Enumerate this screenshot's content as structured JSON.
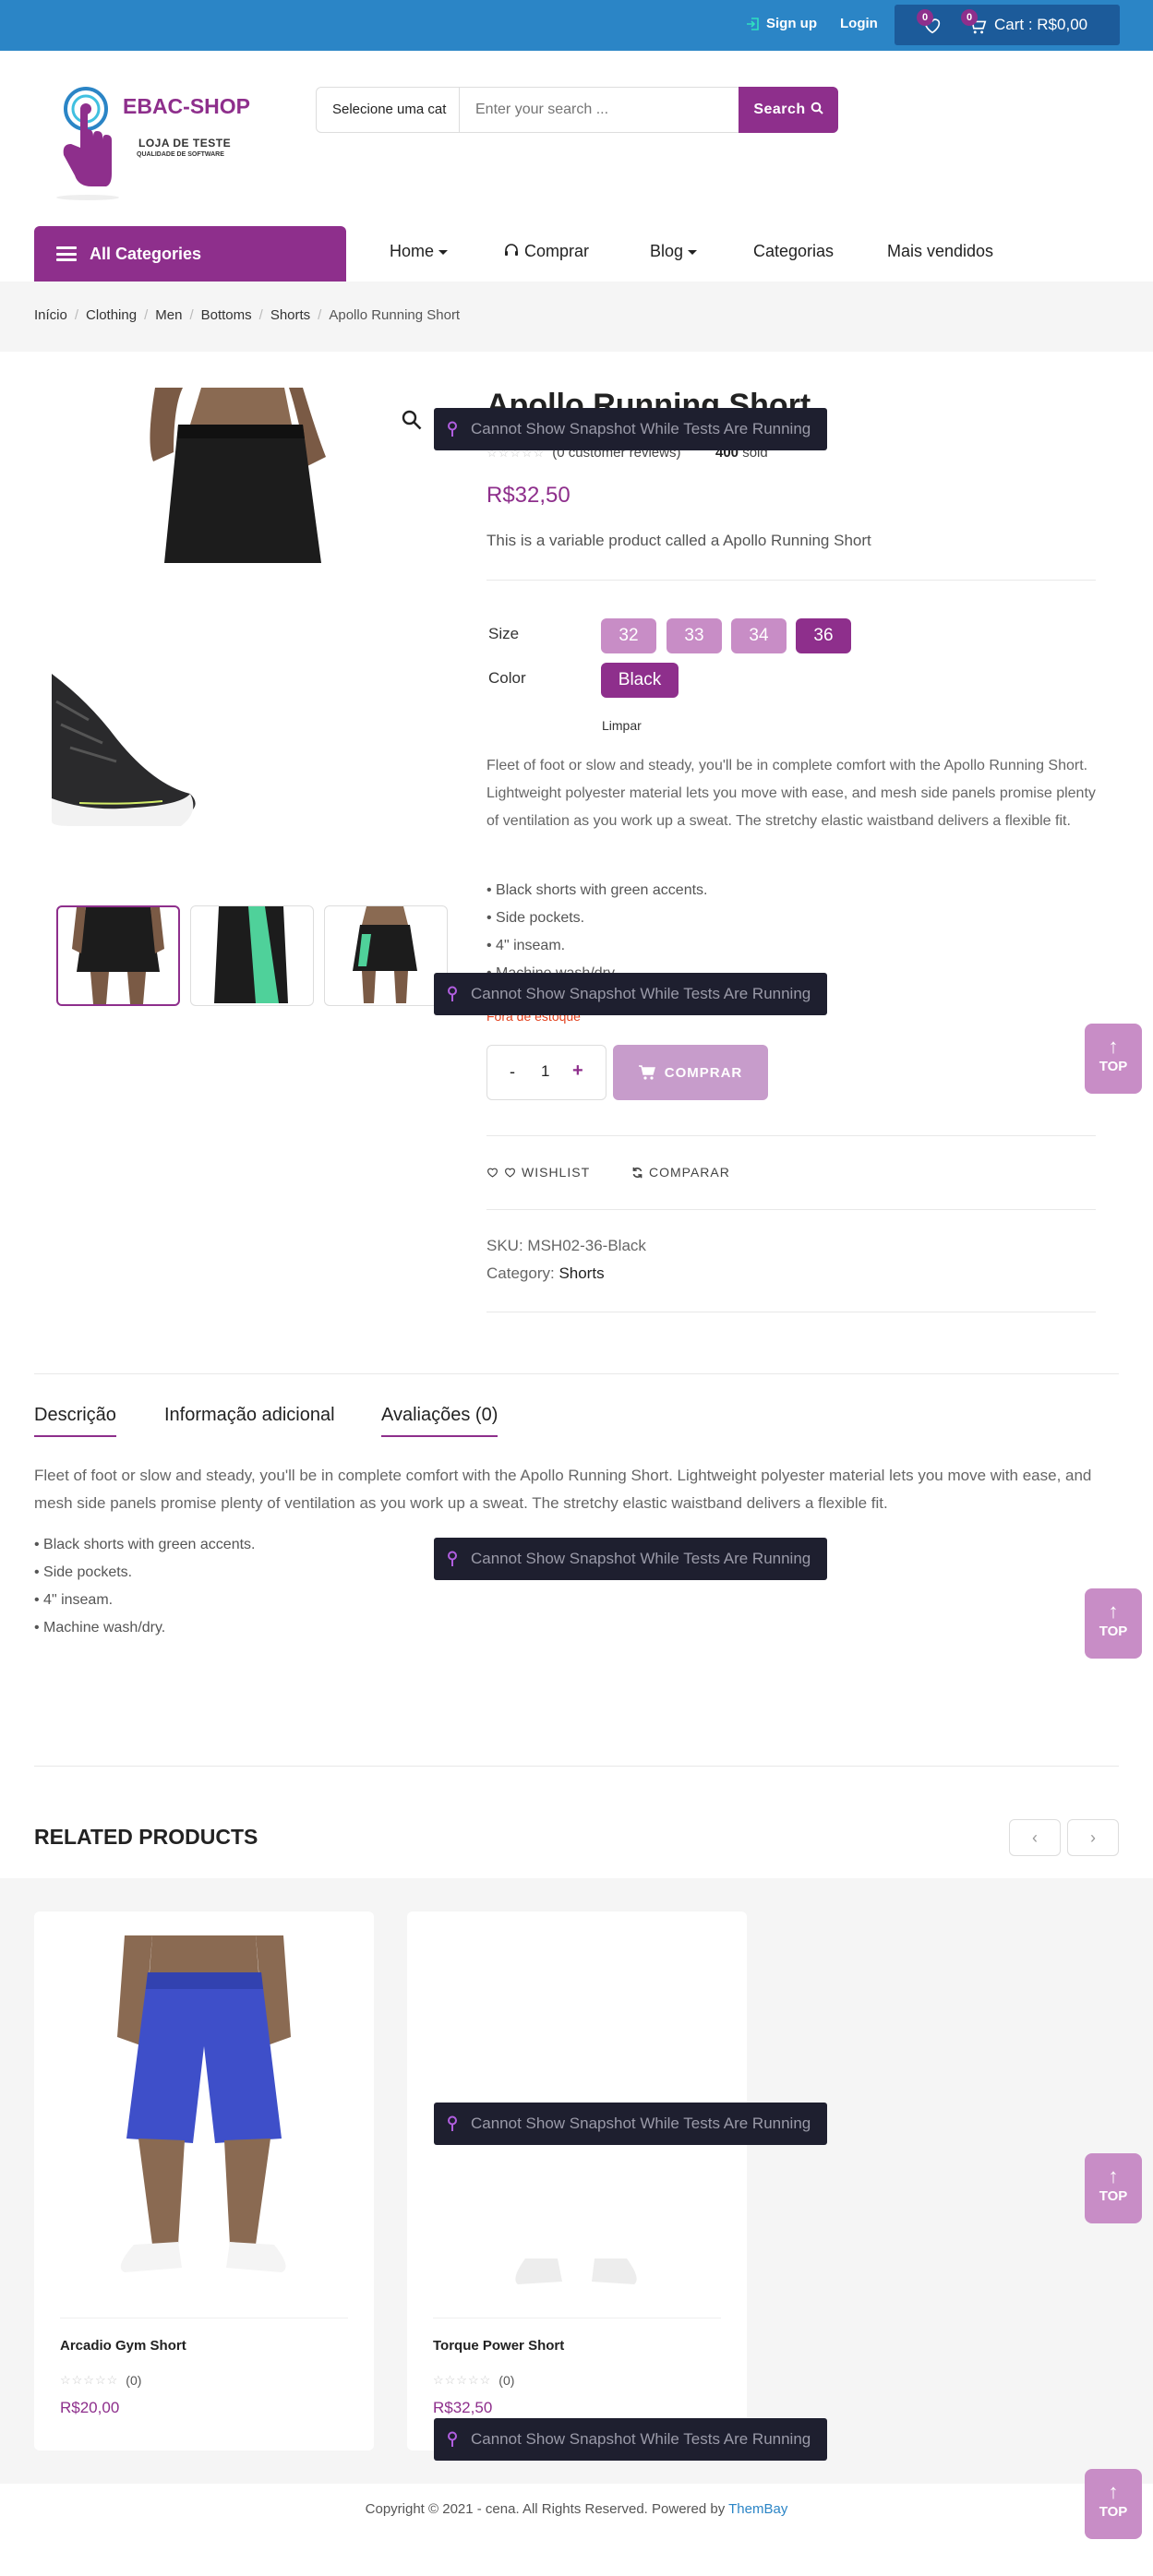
{
  "topbar": {
    "signup": "Sign up",
    "login": "Login",
    "wishlist_count": "0",
    "cart_count": "0",
    "cart_text": "Cart : R$0,00"
  },
  "logo": {
    "brand": "EBAC-SHOP",
    "tagline": "LOJA DE TESTE",
    "tagline_small": "QUALIDADE DE SOFTWARE"
  },
  "search": {
    "category": "Selecione uma cat",
    "placeholder": "Enter your search ...",
    "button": "Search"
  },
  "nav": {
    "all_categories": "All Categories",
    "items": [
      "Home",
      "Comprar",
      "Blog",
      "Categorias",
      "Mais vendidos"
    ]
  },
  "breadcrumb": [
    "Início",
    "Clothing",
    "Men",
    "Bottoms",
    "Shorts",
    "Apollo Running Short"
  ],
  "product": {
    "title": "Apollo Running Short",
    "reviews": "(0 customer reviews)",
    "sold_count": "400",
    "sold_label": "sold",
    "price": "R$32,50",
    "short_desc": "This is a variable product called a Apollo Running Short",
    "size_label": "Size",
    "sizes": [
      "32",
      "33",
      "34",
      "36"
    ],
    "selected_size": "36",
    "color_label": "Color",
    "color": "Black",
    "clear": "Limpar",
    "description": "Fleet of foot or slow and steady, you'll be in complete comfort with the Apollo Running Short. Lightweight polyester material lets you move with ease, and mesh side panels promise plenty of ventilation as you work up a sweat. The stretchy elastic waistband delivers a flexible fit.",
    "bullets": [
      "• Black shorts with green accents.",
      "• Side pockets.",
      "• 4\" inseam.",
      "• Machine wash/dry."
    ],
    "stock": "Fora de estoque",
    "quantity": "1",
    "qty_minus": "-",
    "qty_plus": "+",
    "buy": "COMPRAR",
    "wishlist": "WISHLIST",
    "compare": "COMPARAR",
    "sku_label": "SKU:",
    "sku": "MSH02-36-Black",
    "category_label": "Category:",
    "category": "Shorts"
  },
  "tabs": {
    "items": [
      "Descrição",
      "Informação adicional",
      "Avaliações (0)"
    ],
    "active": "Descrição",
    "description": "Fleet of foot or slow and steady, you'll be in complete comfort with the Apollo Running Short. Lightweight polyester material lets you move with ease, and mesh side panels promise plenty of ventilation as you work up a sweat. The stretchy elastic waistband delivers a flexible fit.",
    "bullets": [
      "• Black shorts with green accents.",
      "• Side pockets.",
      "• 4\" inseam.",
      "• Machine wash/dry."
    ]
  },
  "related": {
    "title": "RELATED PRODUCTS",
    "prev": "‹",
    "next": "›",
    "products": [
      {
        "name": "Arcadio Gym Short",
        "reviews": "(0)",
        "price": "R$20,00"
      },
      {
        "name": "Torque Power Short",
        "reviews": "(0)",
        "price": "R$32,50"
      }
    ]
  },
  "footer": {
    "copyright": "Copyright © 2021 - cena. All Rights Reserved. Powered by",
    "themebay": "ThemBay"
  },
  "overlay": {
    "snapshot_message": "Cannot Show Snapshot While Tests Are Running",
    "top_label": "TOP",
    "top_arrow": "↑"
  },
  "colors": {
    "topbar": "#2b85c6",
    "brand": "#8e2f8c",
    "swatch": "#c88dc6",
    "stock": "#e2401c"
  }
}
